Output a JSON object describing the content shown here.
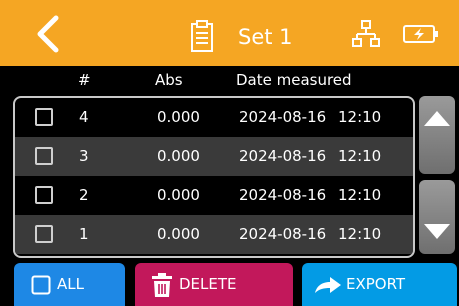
{
  "header": {
    "title": "Set 1",
    "icons": [
      "back-arrow",
      "clipboard",
      "network",
      "battery"
    ]
  },
  "table": {
    "columns": [
      "#",
      "Abs",
      "Date measured"
    ],
    "rows": [
      {
        "num": "4",
        "abs": "0.000",
        "date": "2024-08-16",
        "time": "12:10",
        "checked": false
      },
      {
        "num": "3",
        "abs": "0.000",
        "date": "2024-08-16",
        "time": "12:10",
        "checked": false
      },
      {
        "num": "2",
        "abs": "0.000",
        "date": "2024-08-16",
        "time": "12:10",
        "checked": false
      },
      {
        "num": "1",
        "abs": "0.000",
        "date": "2024-08-16",
        "time": "12:10",
        "checked": false
      }
    ]
  },
  "buttons": {
    "all_label": "ALL",
    "delete_label": "DELETE",
    "export_label": "EXPORT"
  },
  "colors": {
    "header_bg": "#f5a623",
    "all_btn": "#1e88e5",
    "delete_btn": "#c2185b",
    "export_btn": "#039be5",
    "alt_row": "#3a3a3a"
  }
}
